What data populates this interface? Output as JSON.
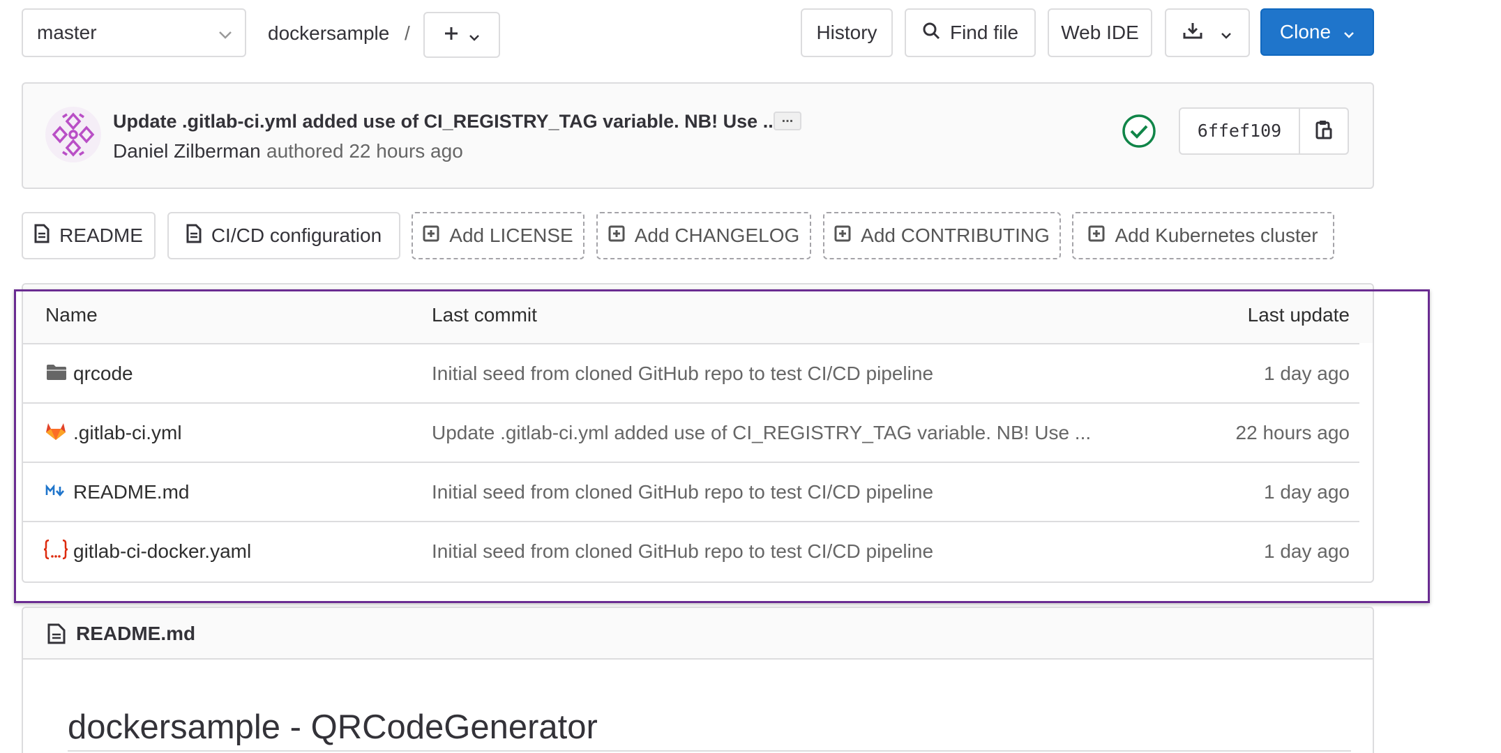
{
  "toolbar": {
    "branch": "master",
    "project": "dockersample",
    "path_separator": "/",
    "add_symbol": "+",
    "history_label": "History",
    "find_file_label": "Find file",
    "web_ide_label": "Web IDE",
    "clone_label": "Clone"
  },
  "commit": {
    "title": "Update .gitlab-ci.yml added use of CI_REGISTRY_TAG variable. NB! Use ...",
    "author": "Daniel Zilberman",
    "authored_text": "authored 22 hours ago",
    "sha": "6ffef109",
    "ellipsis": "...",
    "status": "passed",
    "status_color": "#108548"
  },
  "quick_links": [
    {
      "label": "README",
      "icon": "document-icon",
      "style": "solid"
    },
    {
      "label": "CI/CD configuration",
      "icon": "document-icon",
      "style": "solid"
    },
    {
      "label": "Add LICENSE",
      "icon": "plus-square-icon",
      "style": "dashed"
    },
    {
      "label": "Add CHANGELOG",
      "icon": "plus-square-icon",
      "style": "dashed"
    },
    {
      "label": "Add CONTRIBUTING",
      "icon": "plus-square-icon",
      "style": "dashed"
    },
    {
      "label": "Add Kubernetes cluster",
      "icon": "plus-square-icon",
      "style": "dashed"
    }
  ],
  "file_table": {
    "headers": {
      "name": "Name",
      "last_commit": "Last commit",
      "last_update": "Last update"
    },
    "rows": [
      {
        "icon": "folder-icon",
        "name": "qrcode",
        "commit": "Initial seed from cloned GitHub repo to test CI/CD pipeline",
        "updated": "1 day ago"
      },
      {
        "icon": "gitlab-icon",
        "name": ".gitlab-ci.yml",
        "commit": "Update .gitlab-ci.yml added use of CI_REGISTRY_TAG variable. NB! Use ...",
        "updated": "22 hours ago"
      },
      {
        "icon": "markdown-icon",
        "name": "README.md",
        "commit": "Initial seed from cloned GitHub repo to test CI/CD pipeline",
        "updated": "1 day ago"
      },
      {
        "icon": "yaml-icon",
        "name": "gitlab-ci-docker.yaml",
        "commit": "Initial seed from cloned GitHub repo to test CI/CD pipeline",
        "updated": "1 day ago"
      }
    ]
  },
  "readme": {
    "filename": "README.md",
    "heading": "dockersample - QRCodeGenerator"
  },
  "colors": {
    "accent": "#1f75cb",
    "highlight_border": "#6a2c91",
    "success": "#108548"
  }
}
